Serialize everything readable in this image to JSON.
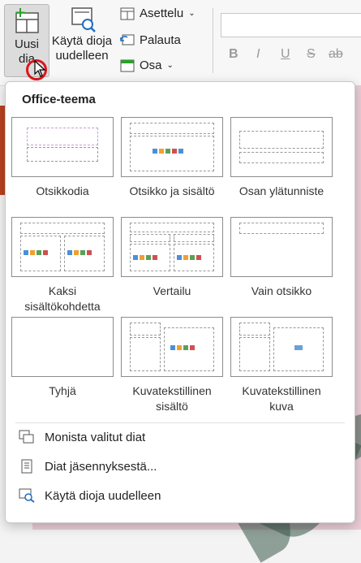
{
  "ribbon": {
    "new_slide_label": "Uusi dia",
    "reuse_label": "Käytä dioja uudelleen",
    "layout_label": "Asettelu",
    "reset_label": "Palauta",
    "section_label": "Osa",
    "format_buttons": [
      "B",
      "I",
      "U",
      "S",
      "ab"
    ]
  },
  "menu": {
    "title": "Office-teema",
    "layouts": [
      {
        "label": "Otsikkodia"
      },
      {
        "label": "Otsikko ja sisältö"
      },
      {
        "label": "Osan ylätunniste"
      },
      {
        "label": "Kaksi sisältökohdetta"
      },
      {
        "label": "Vertailu"
      },
      {
        "label": "Vain otsikko"
      },
      {
        "label": "Tyhjä"
      },
      {
        "label": "Kuvatekstillinen sisältö"
      },
      {
        "label": "Kuvatekstillinen kuva"
      }
    ],
    "commands": [
      {
        "label": "Monista valitut diat",
        "icon": "duplicate-slides-icon"
      },
      {
        "label": "Diat jäsennyksestä...",
        "icon": "outline-document-icon"
      },
      {
        "label": "Käytä dioja uudelleen",
        "icon": "reuse-slides-icon"
      }
    ]
  }
}
